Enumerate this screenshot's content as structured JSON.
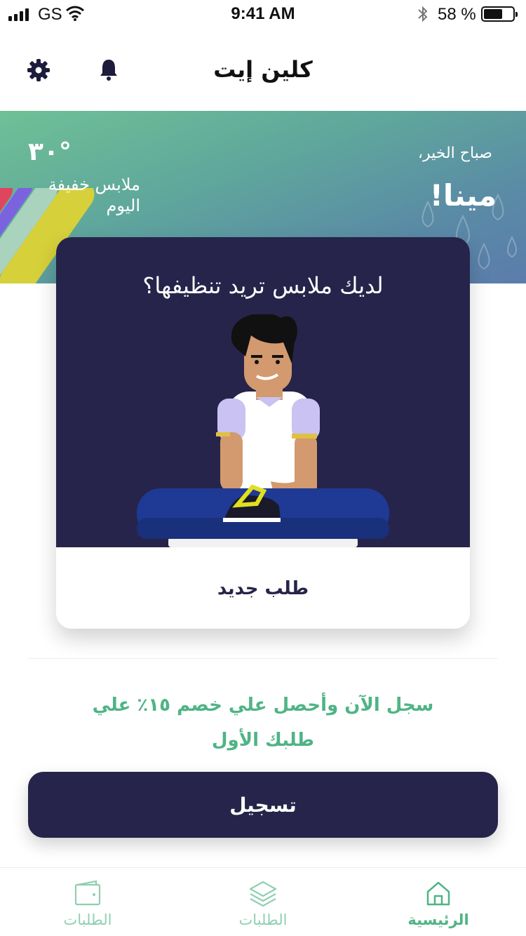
{
  "status_bar": {
    "carrier": "GS",
    "time": "9:41 AM",
    "battery": "58 %",
    "battery_level": 0.58
  },
  "header": {
    "title": "كلين إيت",
    "settings_icon": "gear-icon",
    "notifications_icon": "bell-icon"
  },
  "hero": {
    "greeting": "صباح الخير،",
    "name": "مينا!",
    "temperature": "٣٠°",
    "weather_note": "ملابس خفيفة اليوم"
  },
  "card": {
    "question": "لديك ملابس تريد تنظيفها؟",
    "new_order_label": "طلب جديد"
  },
  "promo": {
    "text": "سجل الآن وأحصل علي خصم ١٥٪ علي طلبك الأول"
  },
  "register_button": "تسجيل",
  "tabs": [
    {
      "label": "الرئيسية",
      "icon": "home-icon",
      "active": true
    },
    {
      "label": "الطلبات",
      "icon": "layers-icon",
      "active": false
    },
    {
      "label": "الطلبات",
      "icon": "wallet-icon",
      "active": false
    }
  ],
  "colors": {
    "brand_dark": "#26244a",
    "accent_green": "#4fb485"
  }
}
